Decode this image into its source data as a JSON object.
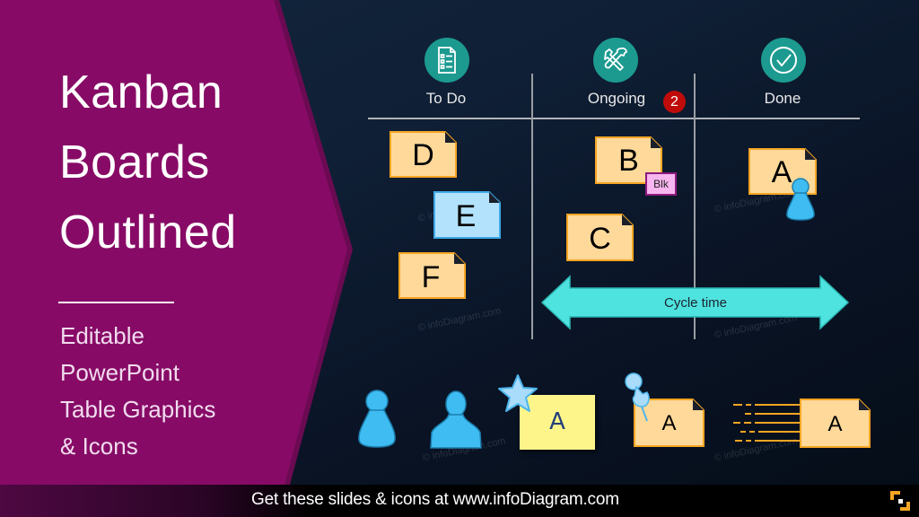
{
  "slide": {
    "title_lines": [
      "Kanban",
      "Boards",
      "Outlined"
    ],
    "subtitle_lines": [
      "Editable",
      "PowerPoint",
      "Table Graphics",
      "& Icons"
    ],
    "colors": {
      "chevron": "#870b66",
      "chevron_border": "#6b0a52",
      "column_icon": "#1c9a90",
      "card_fill": "#fed99a",
      "card_border": "#f5a623",
      "card_blue_fill": "#b3e2fd",
      "card_blue_border": "#3fa9e6",
      "cycle_arrow": "#4fe3df",
      "badge": "#c00b0b",
      "block_tag": "#f7b6ef",
      "sticky_note": "#fdf58a",
      "person": "#3fbdf2"
    }
  },
  "board": {
    "columns": [
      {
        "label": "To Do",
        "icon": "checklist-document-icon"
      },
      {
        "label": "Ongoing",
        "icon": "tools-icon",
        "badge": "2"
      },
      {
        "label": "Done",
        "icon": "checkmark-circle-icon"
      }
    ],
    "cards": [
      {
        "id": "D",
        "column": "To Do",
        "style": "orange"
      },
      {
        "id": "E",
        "column": "To Do",
        "style": "blue"
      },
      {
        "id": "F",
        "column": "To Do",
        "style": "orange"
      },
      {
        "id": "B",
        "column": "Ongoing",
        "style": "orange",
        "tag": "Blk"
      },
      {
        "id": "C",
        "column": "Ongoing",
        "style": "orange"
      },
      {
        "id": "A",
        "column": "Done",
        "style": "orange",
        "assignee": "person-icon"
      }
    ],
    "cycle_time_label": "Cycle time"
  },
  "icon_row": [
    {
      "name": "person-pawn-icon"
    },
    {
      "name": "person-bust-icon"
    },
    {
      "name": "starred-sticky-note",
      "label": "A"
    },
    {
      "name": "pinned-card",
      "label": "A"
    },
    {
      "name": "fast-moving-card",
      "label": "A"
    }
  ],
  "watermark": "© infoDiagram.com",
  "footer": {
    "text": "Get these slides & icons at www.infoDiagram.com",
    "logo": "infodiagram-logo-icon"
  }
}
